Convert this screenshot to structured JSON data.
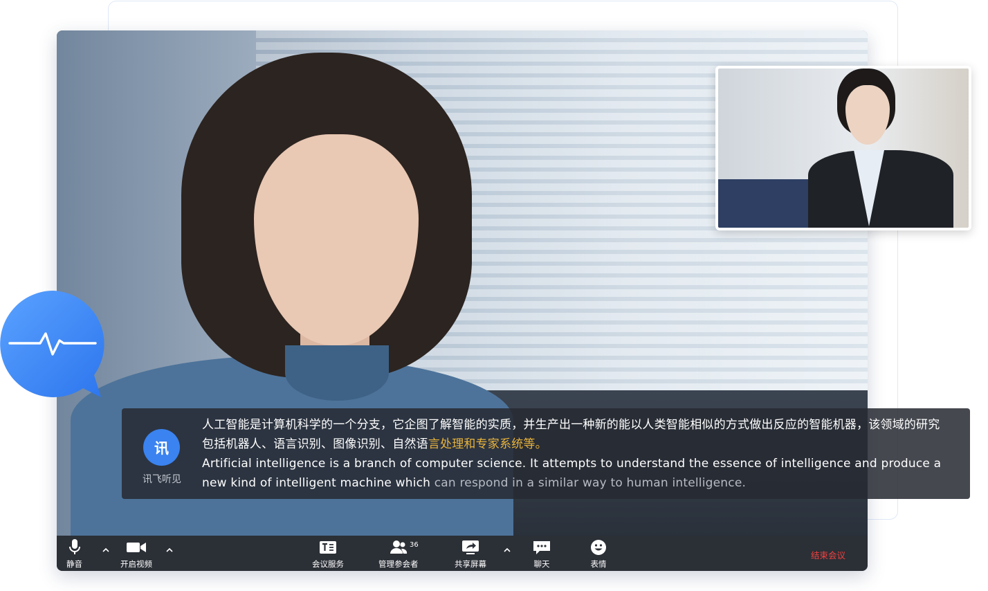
{
  "caption": {
    "speaker_avatar_char": "讯",
    "speaker_name": "讯飞听见",
    "zh_main": "人工智能是计算机科学的一个分支，它企图了解智能的实质，并生产出一种新的能以人类智能相似的方式做出反应的智能机器，该领域的研究包括机器人、语言识别、图像识别、自然语",
    "zh_highlight": "言处理和专家系统等。",
    "en_main": "Artificial intelligence is a branch of computer science. It attempts to understand the essence of intelligence and produce a new kind of intelligent machine which",
    "en_dim": " can respond in a similar way to human intelligence."
  },
  "toolbar": {
    "mute_label": "静音",
    "video_label": "开启视频",
    "meeting_service_label": "会议服务",
    "manage_participants_label": "管理参会者",
    "participant_count": "36",
    "share_screen_label": "共享屏幕",
    "chat_label": "聊天",
    "emoji_label": "表情",
    "end_meeting_label": "结束会议"
  },
  "colors": {
    "accent_blue": "#3a83f0",
    "highlight_yellow": "#e8b33c",
    "end_red": "#f0413e",
    "toolbar_bg": "#2b2f36"
  },
  "icons": {
    "bubble": "waveform-speech-bubble-icon",
    "mute": "microphone-icon",
    "video": "video-camera-icon",
    "meeting_service": "meeting-service-icon",
    "participants": "participants-icon",
    "share": "share-screen-icon",
    "chat": "chat-icon",
    "emoji": "smiley-icon",
    "caret": "chevron-up-icon"
  }
}
